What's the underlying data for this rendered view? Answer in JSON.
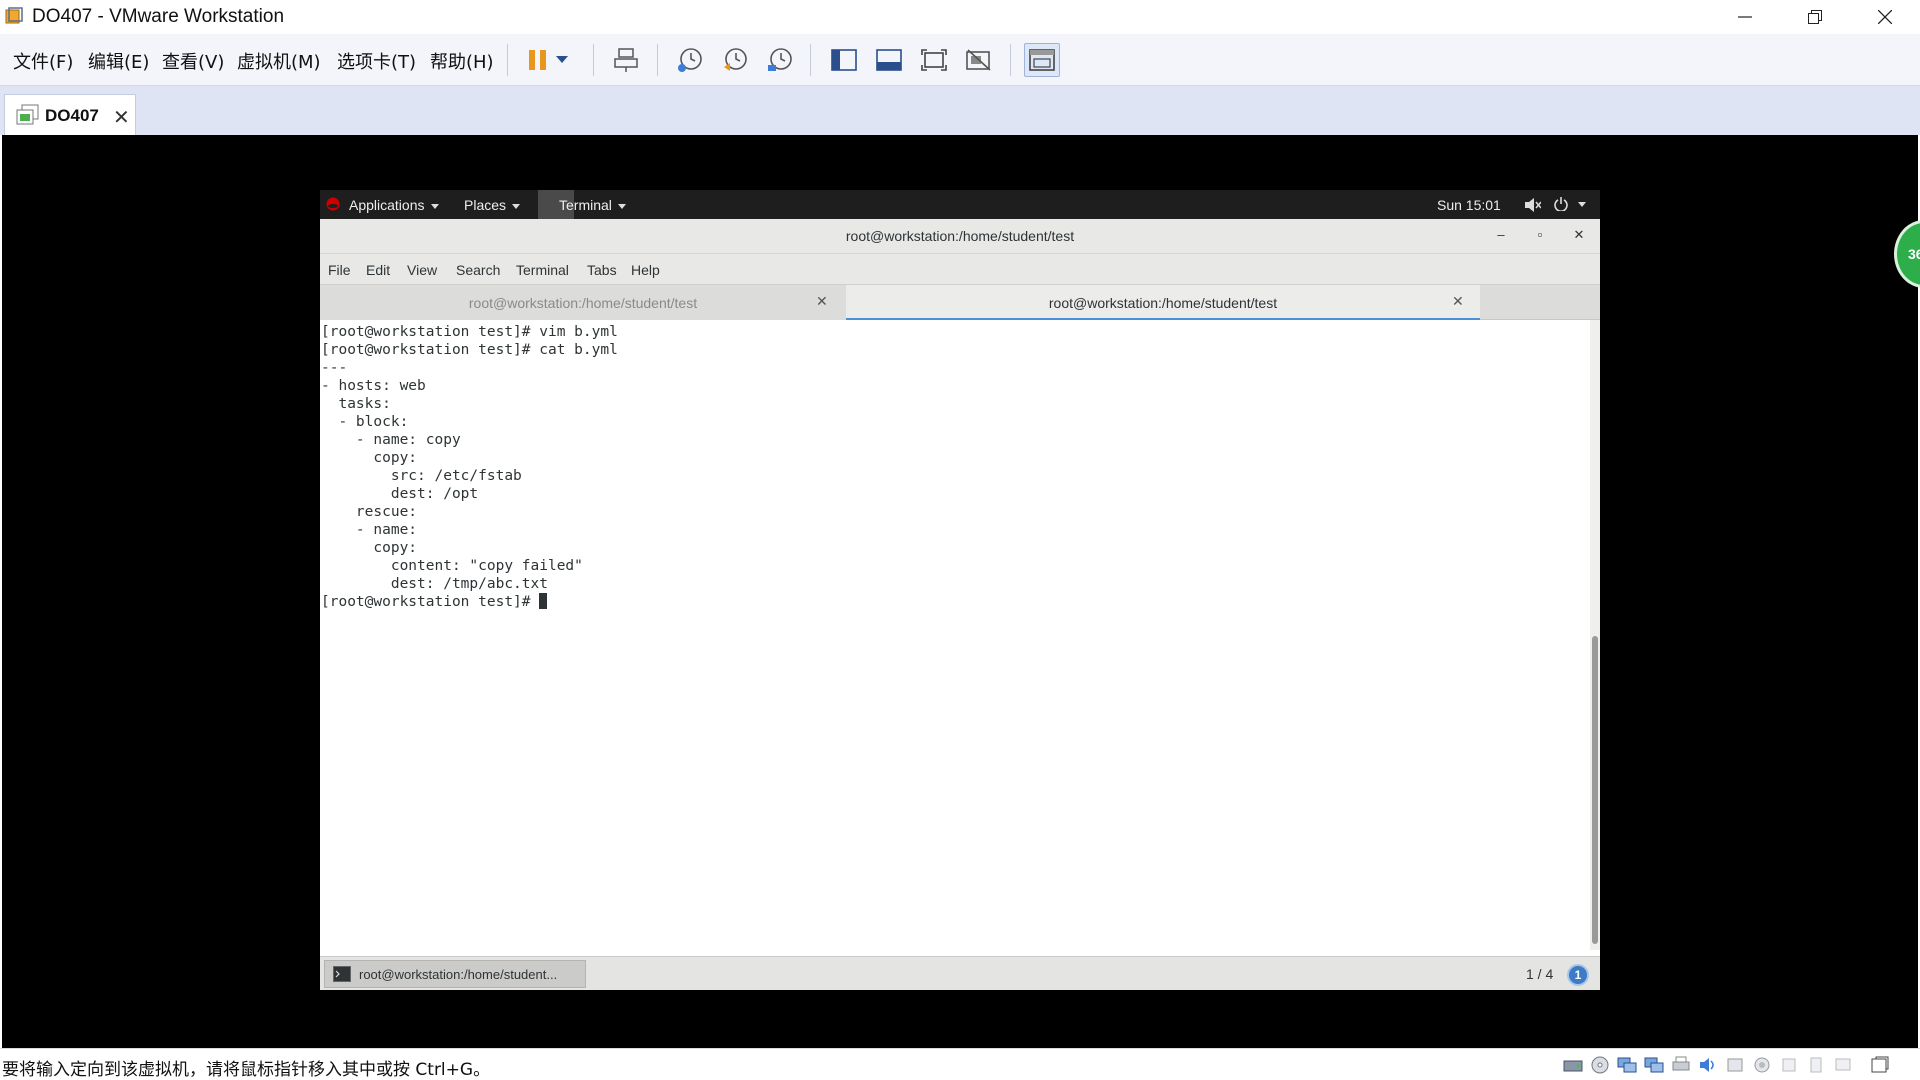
{
  "window": {
    "title": "DO407 - VMware Workstation",
    "controls": {
      "minimize": "minimize",
      "restore": "restore",
      "close": "close"
    }
  },
  "menubar": {
    "items": [
      "文件(F)",
      "编辑(E)",
      "查看(V)",
      "虚拟机(M)",
      "选项卡(T)",
      "帮助(H)"
    ]
  },
  "toolbar": {
    "icons": [
      "pause-icon",
      "dropdown-icon",
      "send-ctrl-alt-del-icon",
      "snapshot-take-icon",
      "snapshot-revert-icon",
      "snapshot-manager-icon",
      "library-icon",
      "console-view-icon",
      "full-screen-icon",
      "unity-icon",
      "thumbnail-view-icon"
    ]
  },
  "vm_tab": {
    "label": "DO407",
    "close": "✕"
  },
  "guest": {
    "topbar": {
      "applications": "Applications",
      "places": "Places",
      "terminal": "Terminal",
      "clock": "Sun 15:01"
    },
    "terminal": {
      "title": "root@workstation:/home/student/test",
      "menu": [
        "File",
        "Edit",
        "View",
        "Search",
        "Terminal",
        "Tabs",
        "Help"
      ],
      "tabs": [
        {
          "label": "root@workstation:/home/student/test",
          "active": false
        },
        {
          "label": "root@workstation:/home/student/test",
          "active": true
        }
      ],
      "lines": [
        "[root@workstation test]# vim b.yml",
        "[root@workstation test]# cat b.yml",
        "---",
        "- hosts: web",
        "  tasks:",
        "  - block:",
        "    - name: copy",
        "      copy:",
        "        src: /etc/fstab",
        "        dest: /opt",
        "    rescue:",
        "    - name:",
        "      copy:",
        "        content: \"copy failed\"",
        "        dest: /tmp/abc.txt"
      ],
      "prompt": "[root@workstation test]# "
    },
    "taskbar": {
      "window_label": "root@workstation:/home/student...",
      "pager": "1 / 4",
      "notifications": "1"
    },
    "side_badge": "36"
  },
  "statusbar": {
    "message": "要将输入定向到该虚拟机，请将鼠标指针移入其中或按 Ctrl+G。"
  },
  "colors": {
    "accent": "#3d7bc4",
    "tab_active_underline": "#4a90d9",
    "badge_green": "#2eae4a",
    "pause_orange": "#e8961c"
  }
}
